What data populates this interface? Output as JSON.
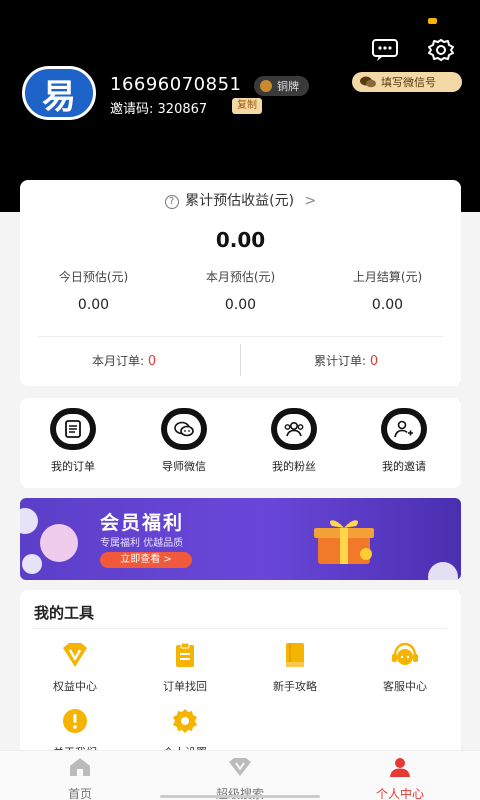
{
  "header": {
    "phone": "16696070851",
    "level_badge": "铜牌",
    "invite_label": "邀请码:",
    "invite_code": "320867",
    "copy_label": "复制",
    "wechat_pill": "填写微信号",
    "avatar_text": "易"
  },
  "earnings": {
    "title": "累计预估收益(元)",
    "title_arrow": ">",
    "total": "0.00",
    "stats": [
      {
        "label": "今日预估(元)",
        "value": "0.00"
      },
      {
        "label": "本月预估(元)",
        "value": "0.00"
      },
      {
        "label": "上月结算(元)",
        "value": "0.00"
      }
    ],
    "month_orders_label": "本月订单:",
    "month_orders_value": "0",
    "total_orders_label": "累计订单:",
    "total_orders_value": "0"
  },
  "quick_actions": [
    {
      "label": "我的订单",
      "icon": "order-list-icon"
    },
    {
      "label": "导师微信",
      "icon": "wechat-icon"
    },
    {
      "label": "我的粉丝",
      "icon": "fans-icon"
    },
    {
      "label": "我的邀请",
      "icon": "invite-user-icon"
    }
  ],
  "banner": {
    "title": "会员福利",
    "subtitle": "专属福利 优越品质",
    "cta": "立即查看 >"
  },
  "tools": {
    "title": "我的工具",
    "items": [
      {
        "label": "权益中心",
        "icon": "vip-diamond-icon"
      },
      {
        "label": "订单找回",
        "icon": "clipboard-icon"
      },
      {
        "label": "新手攻略",
        "icon": "book-icon"
      },
      {
        "label": "客服中心",
        "icon": "customer-service-icon"
      },
      {
        "label": "关于我们",
        "icon": "info-icon"
      },
      {
        "label": "个人设置",
        "icon": "settings-gear-icon"
      }
    ]
  },
  "tabbar": {
    "active": "个人中心",
    "items": [
      {
        "label": "首页",
        "icon": "home-icon"
      },
      {
        "label": "超级搜索",
        "icon": "diamond-search-icon"
      },
      {
        "label": "个人中心",
        "icon": "person-icon"
      }
    ]
  },
  "colors": {
    "accent_gold": "#f5b400",
    "badge_bg": "#f3d9a6",
    "active_red": "#e53935",
    "banner_purple": "#6a47d9"
  }
}
